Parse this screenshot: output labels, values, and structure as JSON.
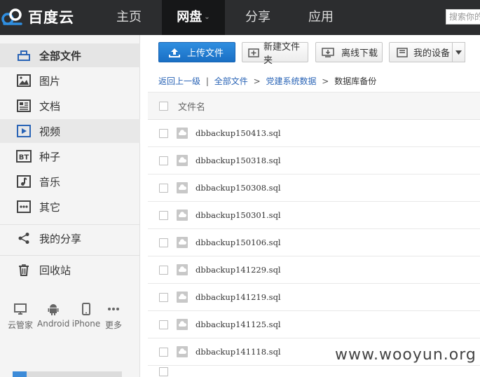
{
  "logo": {
    "text": "百度云"
  },
  "nav": [
    {
      "label": "主页",
      "active": false
    },
    {
      "label": "网盘",
      "active": true,
      "caret": "⌄"
    },
    {
      "label": "分享",
      "active": false
    },
    {
      "label": "应用",
      "active": false
    }
  ],
  "search": {
    "placeholder": "搜索你的"
  },
  "sidebar": {
    "items": [
      {
        "label": "全部文件",
        "icon": "folder-icon"
      },
      {
        "label": "图片",
        "icon": "image-icon"
      },
      {
        "label": "文档",
        "icon": "document-icon"
      },
      {
        "label": "视频",
        "icon": "video-icon"
      },
      {
        "label": "种子",
        "icon": "bt-icon",
        "icon_text": "BT"
      },
      {
        "label": "音乐",
        "icon": "music-icon"
      },
      {
        "label": "其它",
        "icon": "more-dots-icon"
      },
      {
        "label": "我的分享",
        "icon": "share-icon"
      },
      {
        "label": "回收站",
        "icon": "trash-icon"
      }
    ],
    "devices": [
      {
        "label": "云管家",
        "icon": "monitor-icon"
      },
      {
        "label": "Android",
        "icon": "android-icon"
      },
      {
        "label": "iPhone",
        "icon": "phone-icon"
      },
      {
        "label": "更多",
        "icon": "more-icon"
      }
    ]
  },
  "toolbar": {
    "upload": "上传文件",
    "new_folder": "新建文件夹",
    "offline_download": "离线下载",
    "my_devices": "我的设备"
  },
  "breadcrumb": {
    "back": "返回上一级",
    "divider": "|",
    "root": "全部文件",
    "sep": ">",
    "parent": "党建系统数据",
    "current": "数据库备份"
  },
  "list": {
    "header": "文件名",
    "files": [
      "dbbackup150413.sql",
      "dbbackup150318.sql",
      "dbbackup150308.sql",
      "dbbackup150301.sql",
      "dbbackup150106.sql",
      "dbbackup141229.sql",
      "dbbackup141219.sql",
      "dbbackup141125.sql",
      "dbbackup141118.sql"
    ]
  },
  "watermark": "www.wooyun.org",
  "colors": {
    "topbar": "#2c2d2f",
    "accent": "#1f7fd8",
    "link": "#2a64b6"
  }
}
